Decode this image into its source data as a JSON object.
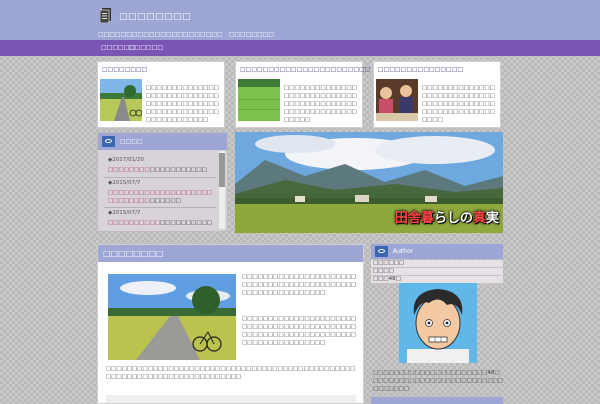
{
  "header": {
    "site_title": "□□□□□□□□",
    "tagline": "□□□□□□□□□□□□□□□□□□□□□□　□□□□□□□□"
  },
  "nav": {
    "items": [
      {
        "label": "□□□□□□"
      },
      {
        "label": "□□□□□□"
      }
    ]
  },
  "features": [
    {
      "title": "□□□□□□□□",
      "text": "□□□□□□□□□□□□□□□□□□□□□□□□□□□□□□□□□□□□□□□□□□□□□□□□□□□□□□□□□□□□□□□□□□□□"
    },
    {
      "title": "□□□□□□□□□□□□□□□□□□□□□□□",
      "text": "□□□□□□□□□□□□□□□□□□□□□□□□□□□□□□□□□□□□□□□□□□□□□□□□□□□□□□□□□□□□□"
    },
    {
      "title": "□□□□□□□□□□□□□□□",
      "text": "□□□□□□□□□□□□□□□□□□□□□□□□□□□□□□□□□□□□□□□□□□□□□□□□□□□□□□□□□□□□"
    }
  ],
  "news": {
    "title": "□□□□",
    "items": [
      {
        "date": "◆2017/01/20",
        "link": "□□□□□□□□",
        "rest": "□□□□□□□□□□□"
      },
      {
        "date": "◆2015/07/7",
        "link": "□□□□□□□□□□□□□□□□□□□□□□□□□□□□",
        "rest": "□□□□□□"
      },
      {
        "date": "◆2015/07/7",
        "link": "□□□□□□□□□□",
        "rest": "□□□□□□□□□□"
      }
    ]
  },
  "banner": {
    "caption_1": "田舎",
    "caption_2": "暮",
    "caption_3": "らしの",
    "caption_4": "真",
    "caption_5": "実"
  },
  "main": {
    "title": "□□□□□□□□",
    "text_1": "□□□□□□□□□□□□□□□□□□□□□□□□□□□□□□□□□□□□□□□□□□□□□□□□□□□□□□□□□□□□",
    "text_2": "□□□□□□□□□□□□□□□□□□□□□□□□□□□□□□□□□□□□□□□□□□□□□□□□□□□□□□□□□□□□□□□□□□□□□□□□□□□□□□□□□□",
    "text_3": "□□□□□□□□□□□□□□□□□□□□□□□□□□□□□□□□□□□□□□□□□□□□□□□□□□□□□□□□□□□□□□□□□□□□□□□□□□"
  },
  "author": {
    "title": "Author",
    "rows": [
      "□□□□□□",
      "□□□□",
      "□□□48□"
    ],
    "text": "□□□□□□□□□□□□□□□□□□□□□□48□□□□□□□□□□□□□□□□□□□□□□□□□□□□□□□□□"
  },
  "colors": {
    "header_bg": "#9ea6d6",
    "nav_bg": "#7a55b3",
    "link": "#b02b60"
  }
}
